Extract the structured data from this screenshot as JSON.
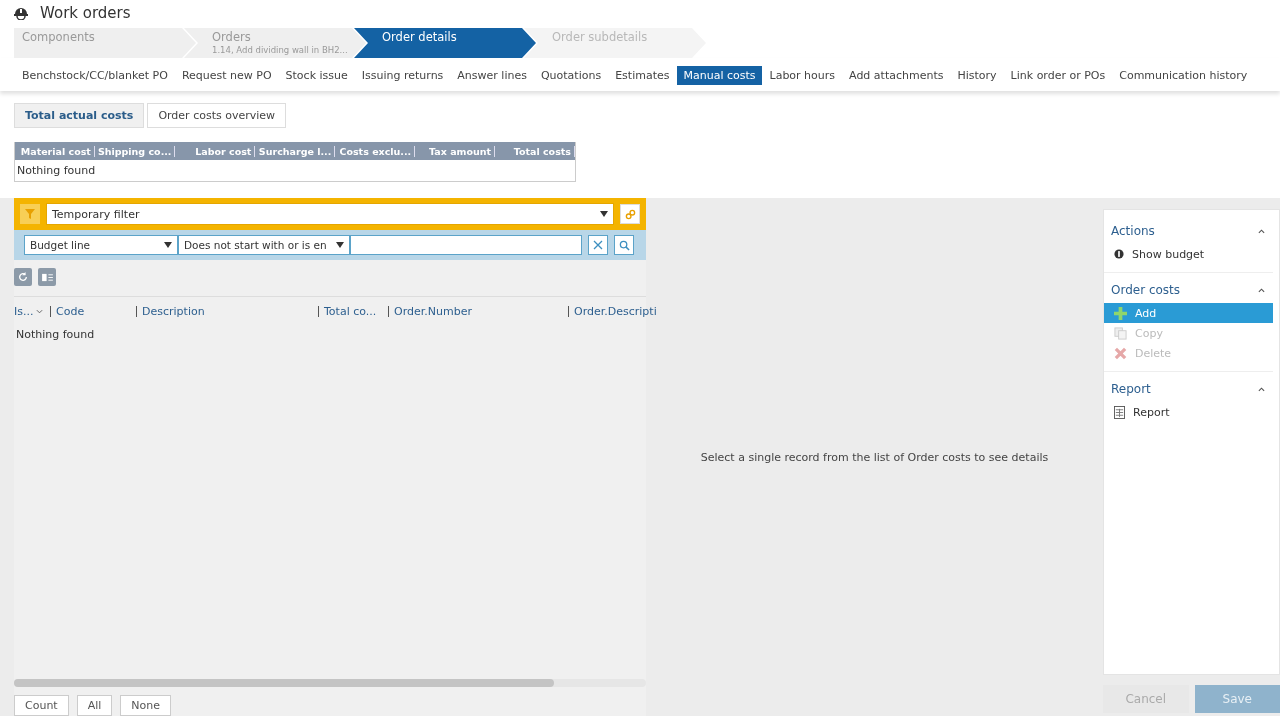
{
  "window": {
    "title": "Work orders"
  },
  "breadcrumb": [
    {
      "label": "Components",
      "selected": false,
      "disabled": false
    },
    {
      "label": "Orders",
      "subtitle": "1.14, Add dividing wall in BH2...",
      "selected": false,
      "disabled": false
    },
    {
      "label": "Order details",
      "selected": true,
      "disabled": false
    },
    {
      "label": "Order subdetails",
      "selected": false,
      "disabled": true
    }
  ],
  "tabs": [
    {
      "label": "Benchstock/CC/blanket PO",
      "selected": false
    },
    {
      "label": "Request new PO",
      "selected": false
    },
    {
      "label": "Stock issue",
      "selected": false
    },
    {
      "label": "Issuing returns",
      "selected": false
    },
    {
      "label": "Answer lines",
      "selected": false
    },
    {
      "label": "Quotations",
      "selected": false
    },
    {
      "label": "Estimates",
      "selected": false
    },
    {
      "label": "Manual costs",
      "selected": true
    },
    {
      "label": "Labor hours",
      "selected": false
    },
    {
      "label": "Add attachments",
      "selected": false
    },
    {
      "label": "History",
      "selected": false
    },
    {
      "label": "Link order or POs",
      "selected": false
    },
    {
      "label": "Communication history",
      "selected": false
    }
  ],
  "subtabs": [
    {
      "label": "Total actual costs",
      "selected": true
    },
    {
      "label": "Order costs overview",
      "selected": false
    }
  ],
  "totals_table": {
    "columns": [
      "Material cost",
      "Shipping co...",
      "Labor cost",
      "Surcharge l...",
      "Costs exclu...",
      "Tax amount",
      "Total costs"
    ],
    "empty_text": "Nothing found"
  },
  "filter": {
    "preset": "Temporary filter",
    "field": "Budget line",
    "operator": "Does not start with or is en"
  },
  "list": {
    "columns": [
      "Is...",
      "Code",
      "Description",
      "Total co...",
      "Order.Number",
      "Order.Descripti"
    ],
    "empty_text": "Nothing found"
  },
  "bottom_buttons": [
    "Count",
    "All",
    "None"
  ],
  "detail_message": "Select a single record from the list of Order costs to see details",
  "action_groups": [
    {
      "title": "Actions",
      "expanded": true,
      "items": [
        {
          "label": "Show budget",
          "kind": "budget",
          "disabled": false,
          "highlighted": false
        }
      ]
    },
    {
      "title": "Order costs",
      "expanded": true,
      "items": [
        {
          "label": "Add",
          "kind": "add",
          "disabled": false,
          "highlighted": true
        },
        {
          "label": "Copy",
          "kind": "copy",
          "disabled": true,
          "highlighted": false
        },
        {
          "label": "Delete",
          "kind": "delete",
          "disabled": true,
          "highlighted": false
        }
      ]
    },
    {
      "title": "Report",
      "expanded": true,
      "items": [
        {
          "label": "Report",
          "kind": "report",
          "disabled": false,
          "highlighted": false
        }
      ]
    }
  ],
  "footer_buttons": [
    {
      "label": "Cancel",
      "disabled": true,
      "primary": false
    },
    {
      "label": "Save",
      "disabled": true,
      "primary": true
    }
  ]
}
